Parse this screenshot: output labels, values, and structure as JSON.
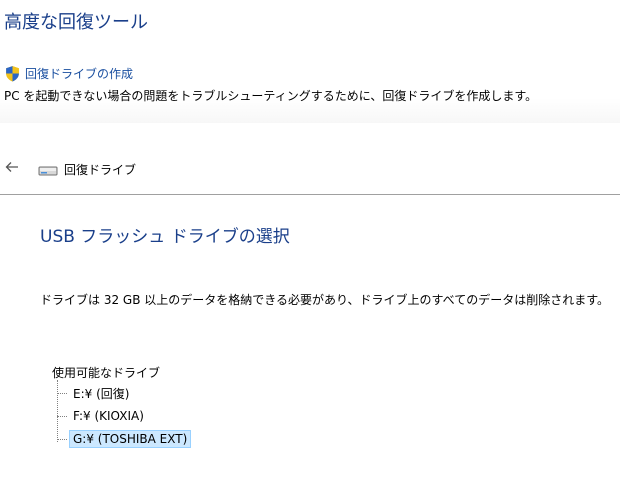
{
  "header": {
    "title": "高度な回復ツール",
    "link_label": "回復ドライブの作成",
    "description": "PC を起動できない場合の問題をトラブルシューティングするために、回復ドライブを作成します。"
  },
  "nav": {
    "title": "回復ドライブ"
  },
  "main": {
    "heading": "USB フラッシュ ドライブの選択",
    "instructions": "ドライブは 32 GB 以上のデータを格納できる必要があり、ドライブ上のすべてのデータは削除されます。"
  },
  "drives": {
    "group_label": "使用可能なドライブ",
    "items": [
      {
        "label": "E:¥ (回復)",
        "selected": false
      },
      {
        "label": "F:¥ (KIOXIA)",
        "selected": false
      },
      {
        "label": "G:¥ (TOSHIBA EXT)",
        "selected": true
      }
    ]
  },
  "colors": {
    "heading_blue": "#1a3f8a",
    "link_blue": "#1a4fa0",
    "selection_bg": "#cce8ff",
    "selection_border": "#99d1ff"
  },
  "icons": {
    "shield": "uac-shield-icon",
    "back": "back-arrow-icon",
    "drive": "drive-icon"
  }
}
